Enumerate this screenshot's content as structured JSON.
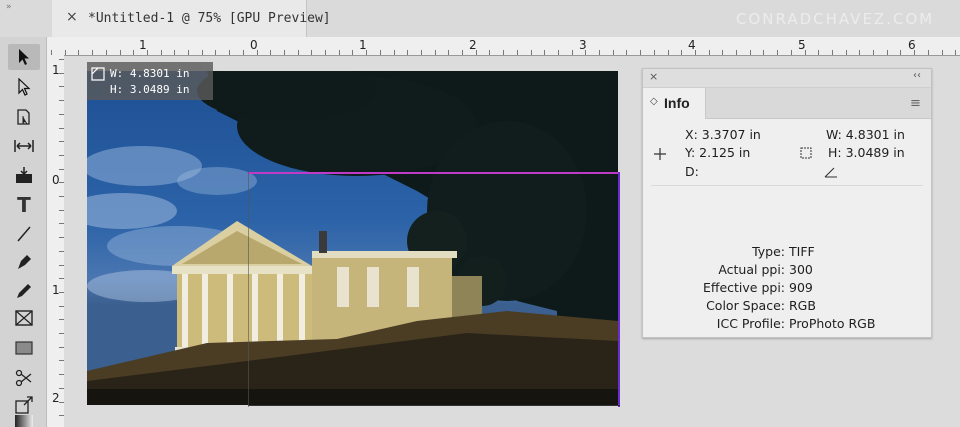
{
  "tabbar": {
    "collapse_glyph": "»",
    "close_glyph": "×",
    "doc_title": "*Untitled-1 @ 75% [GPU Preview]",
    "watermark": "CONRADCHAVEZ.COM"
  },
  "ruler": {
    "top_labels": [
      "1",
      "0",
      "1",
      "2",
      "3",
      "4",
      "5",
      "6"
    ],
    "left_labels": [
      "1",
      "0",
      "1",
      "2"
    ]
  },
  "size_tooltip": {
    "width": "W: 4.8301 in",
    "height": "H: 3.0489 in"
  },
  "info_panel": {
    "close_glyph": "×",
    "collapse_glyph": "‹‹",
    "tab_arrow": "◇",
    "tab_label": "Info",
    "menu_glyph": "≡",
    "x": "X: 3.3707 in",
    "y": "Y: 2.125 in",
    "d": "D:",
    "w": "W: 4.8301 in",
    "h": "H: 3.0489 in",
    "metadata": [
      {
        "label": "Type:",
        "value": "TIFF"
      },
      {
        "label": "Actual ppi:",
        "value": "300"
      },
      {
        "label": "Effective ppi:",
        "value": "909"
      },
      {
        "label": "Color Space:",
        "value": "RGB"
      },
      {
        "label": "ICC Profile:",
        "value": "ProPhoto RGB"
      }
    ]
  },
  "colors": {
    "frame_edge_top": "#c03ac8",
    "frame_edge_right": "#6a2bd0",
    "sky": "#2c63a8"
  }
}
